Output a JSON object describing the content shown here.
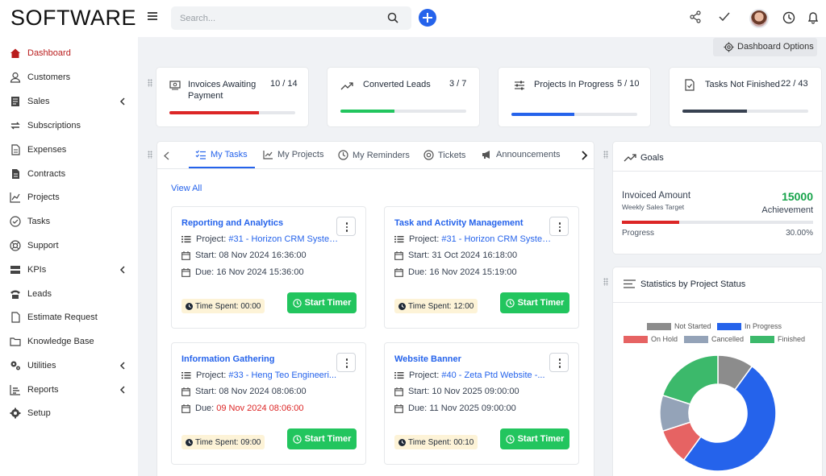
{
  "app": {
    "logo": "SOFTWARE"
  },
  "search": {
    "placeholder": "Search..."
  },
  "colors": {
    "accent": "#2563eb",
    "active_nav": "#b91c1c",
    "success": "#22c55e",
    "danger": "#dc2626"
  },
  "sidebar": {
    "items": [
      {
        "label": "Dashboard",
        "icon": "home-icon",
        "active": true
      },
      {
        "label": "Customers",
        "icon": "user-icon"
      },
      {
        "label": "Sales",
        "icon": "receipt-icon",
        "chevron": true
      },
      {
        "label": "Subscriptions",
        "icon": "repeat-icon"
      },
      {
        "label": "Expenses",
        "icon": "file-icon"
      },
      {
        "label": "Contracts",
        "icon": "contract-icon"
      },
      {
        "label": "Projects",
        "icon": "chart-icon"
      },
      {
        "label": "Tasks",
        "icon": "check-circle-icon"
      },
      {
        "label": "Support",
        "icon": "lifebuoy-icon"
      },
      {
        "label": "KPIs",
        "icon": "server-icon",
        "chevron": true
      },
      {
        "label": "Leads",
        "icon": "phone-icon"
      },
      {
        "label": "Estimate Request",
        "icon": "file-icon"
      },
      {
        "label": "Knowledge Base",
        "icon": "folder-icon"
      },
      {
        "label": "Utilities",
        "icon": "gears-icon",
        "chevron": true
      },
      {
        "label": "Reports",
        "icon": "report-icon",
        "chevron": true
      },
      {
        "label": "Setup",
        "icon": "gear-icon"
      }
    ]
  },
  "dashboard_options": {
    "label": "Dashboard Options"
  },
  "kpis": [
    {
      "title": "Invoices Awaiting Payment",
      "value": "10 / 14",
      "progress": 0.714,
      "color": "#dc2626"
    },
    {
      "title": "Converted Leads",
      "value": "3 / 7",
      "progress": 0.43,
      "color": "#22c55e"
    },
    {
      "title": "Projects In Progress",
      "value": "5 / 10",
      "progress": 0.5,
      "color": "#2563eb"
    },
    {
      "title": "Tasks Not Finished",
      "value": "22 / 43",
      "progress": 0.51,
      "color": "#374151"
    }
  ],
  "tabs": [
    "My Tasks",
    "My Projects",
    "My Reminders",
    "Tickets",
    "Announcements"
  ],
  "view_all": "View All",
  "tasks": [
    {
      "title": "Reporting and Analytics",
      "project_label": "Project:",
      "project": "#31 - Horizon CRM System...",
      "start_label": "Start:",
      "start": "08 Nov 2024 16:36:00",
      "due_label": "Due:",
      "due": "16 Nov 2024 15:36:00",
      "overdue": false,
      "spent_label": "Time Spent:",
      "spent": "00:00",
      "timer": "Start Timer"
    },
    {
      "title": "Task and Activity Management",
      "project_label": "Project:",
      "project": "#31 - Horizon CRM System...",
      "start_label": "Start:",
      "start": "31 Oct 2024 16:18:00",
      "due_label": "Due:",
      "due": "16 Nov 2024 15:19:00",
      "overdue": false,
      "spent_label": "Time Spent:",
      "spent": "12:00",
      "timer": "Start Timer"
    },
    {
      "title": "Information Gathering",
      "project_label": "Project:",
      "project": "#33 - Heng Teo Engineeri...",
      "start_label": "Start:",
      "start": "08 Nov 2024 08:06:00",
      "due_label": "Due:",
      "due": "09 Nov 2024 08:06:00",
      "overdue": true,
      "spent_label": "Time Spent:",
      "spent": "09:00",
      "timer": "Start Timer"
    },
    {
      "title": "Website Banner",
      "project_label": "Project:",
      "project": "#40 - Zeta Ptd Website -...",
      "start_label": "Start:",
      "start": "10 Nov 2025 09:00:00",
      "due_label": "Due:",
      "due": "11 Nov 2025 09:00:00",
      "overdue": false,
      "spent_label": "Time Spent:",
      "spent": "00:10",
      "timer": "Start Timer"
    }
  ],
  "goals": {
    "title": "Goals",
    "label": "Invoiced Amount",
    "sublabel": "Weekly Sales Target",
    "value": "15000",
    "value_caption": "Achievement",
    "progress_label": "Progress",
    "progress_text": "30.00%",
    "progress": 0.3
  },
  "project_stats": {
    "title": "Statistics by Project Status"
  },
  "chart_data": {
    "type": "pie",
    "title": "",
    "categories": [
      "Not Started",
      "In Progress",
      "On Hold",
      "Cancelled",
      "Finished"
    ],
    "values": [
      1,
      5,
      1,
      1,
      2
    ],
    "colors": [
      "#8c8c8c",
      "#2563eb",
      "#e66363",
      "#94a3b8",
      "#3cb96b"
    ]
  }
}
